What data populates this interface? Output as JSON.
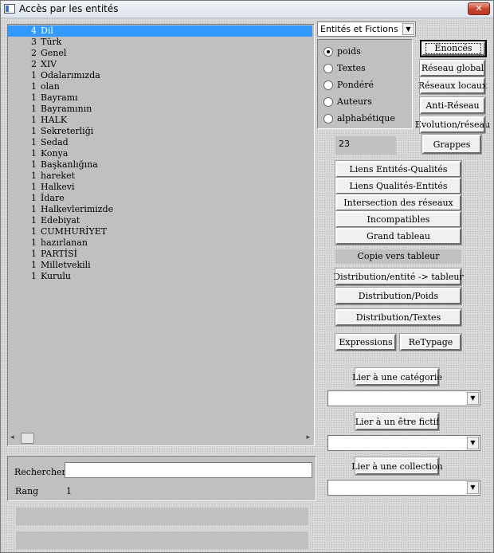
{
  "window": {
    "title": "Accès par les entités",
    "close_glyph": "✕"
  },
  "list": {
    "items": [
      {
        "count": "4",
        "label": "Dil",
        "selected": true
      },
      {
        "count": "3",
        "label": "Türk"
      },
      {
        "count": "2",
        "label": "Genel"
      },
      {
        "count": "2",
        "label": "XIV"
      },
      {
        "count": "1",
        "label": "Odalarımızda"
      },
      {
        "count": "1",
        "label": "olan"
      },
      {
        "count": "1",
        "label": "Bayramı"
      },
      {
        "count": "1",
        "label": "Bayramının"
      },
      {
        "count": "1",
        "label": "HALK"
      },
      {
        "count": "1",
        "label": "Sekreterliği"
      },
      {
        "count": "1",
        "label": "Sedad"
      },
      {
        "count": "1",
        "label": "Konya"
      },
      {
        "count": "1",
        "label": "Başkanlığına"
      },
      {
        "count": "1",
        "label": "hareket"
      },
      {
        "count": "1",
        "label": "Halkevi"
      },
      {
        "count": "1",
        "label": "İdare"
      },
      {
        "count": "1",
        "label": "Halkevlerimizde"
      },
      {
        "count": "1",
        "label": "Edebiyat"
      },
      {
        "count": "1",
        "label": "CUMHURİYET"
      },
      {
        "count": "1",
        "label": "hazırlanan"
      },
      {
        "count": "1",
        "label": "PARTİSİ"
      },
      {
        "count": "1",
        "label": "Milletvekili"
      },
      {
        "count": "1",
        "label": "Kurulu"
      }
    ],
    "scroll_left_glyph": "◂",
    "scroll_right_glyph": "▸"
  },
  "search": {
    "label": "Rechercher",
    "value": "",
    "rang_label": "Rang",
    "rang_value": "1"
  },
  "type_select": {
    "value": "Entités et Fictions",
    "arrow_glyph": "▼"
  },
  "sort_options": [
    {
      "label": "poids",
      "checked": true
    },
    {
      "label": "Textes",
      "checked": false
    },
    {
      "label": "Pondéré",
      "checked": false
    },
    {
      "label": "Auteurs",
      "checked": false
    },
    {
      "label": "alphabétique",
      "checked": false
    }
  ],
  "side_buttons": {
    "enonces": "Énoncés",
    "reseau_global": "Réseau global",
    "reseaux_locaux": "Réseaux locaux",
    "anti_reseau": "Anti-Réseau",
    "evolution_reseau": "Evolution/réseau",
    "grappes": "Grappes"
  },
  "count_value": "23",
  "main_buttons": {
    "liens_entites_qualites": "Liens Entités-Qualités",
    "liens_qualites_entites": "Liens Qualités-Entités",
    "intersection": "Intersection des réseaux",
    "incompatibles": "Incompatibles",
    "grand_tableau": "Grand tableau",
    "copie_label": "Copie vers tableur",
    "distribution_entite": "Distribution/entité -> tableur",
    "distribution_poids": "Distribution/Poids",
    "distribution_textes": "Distribution/Textes",
    "expressions": "Expressions",
    "retypage": "ReTypage"
  },
  "links": {
    "categorie_button": "Lier à une catégorie",
    "fictif_button": "Lier à un être fictif",
    "collection_button": "Lier à une collection",
    "arrow_glyph": "▼"
  }
}
